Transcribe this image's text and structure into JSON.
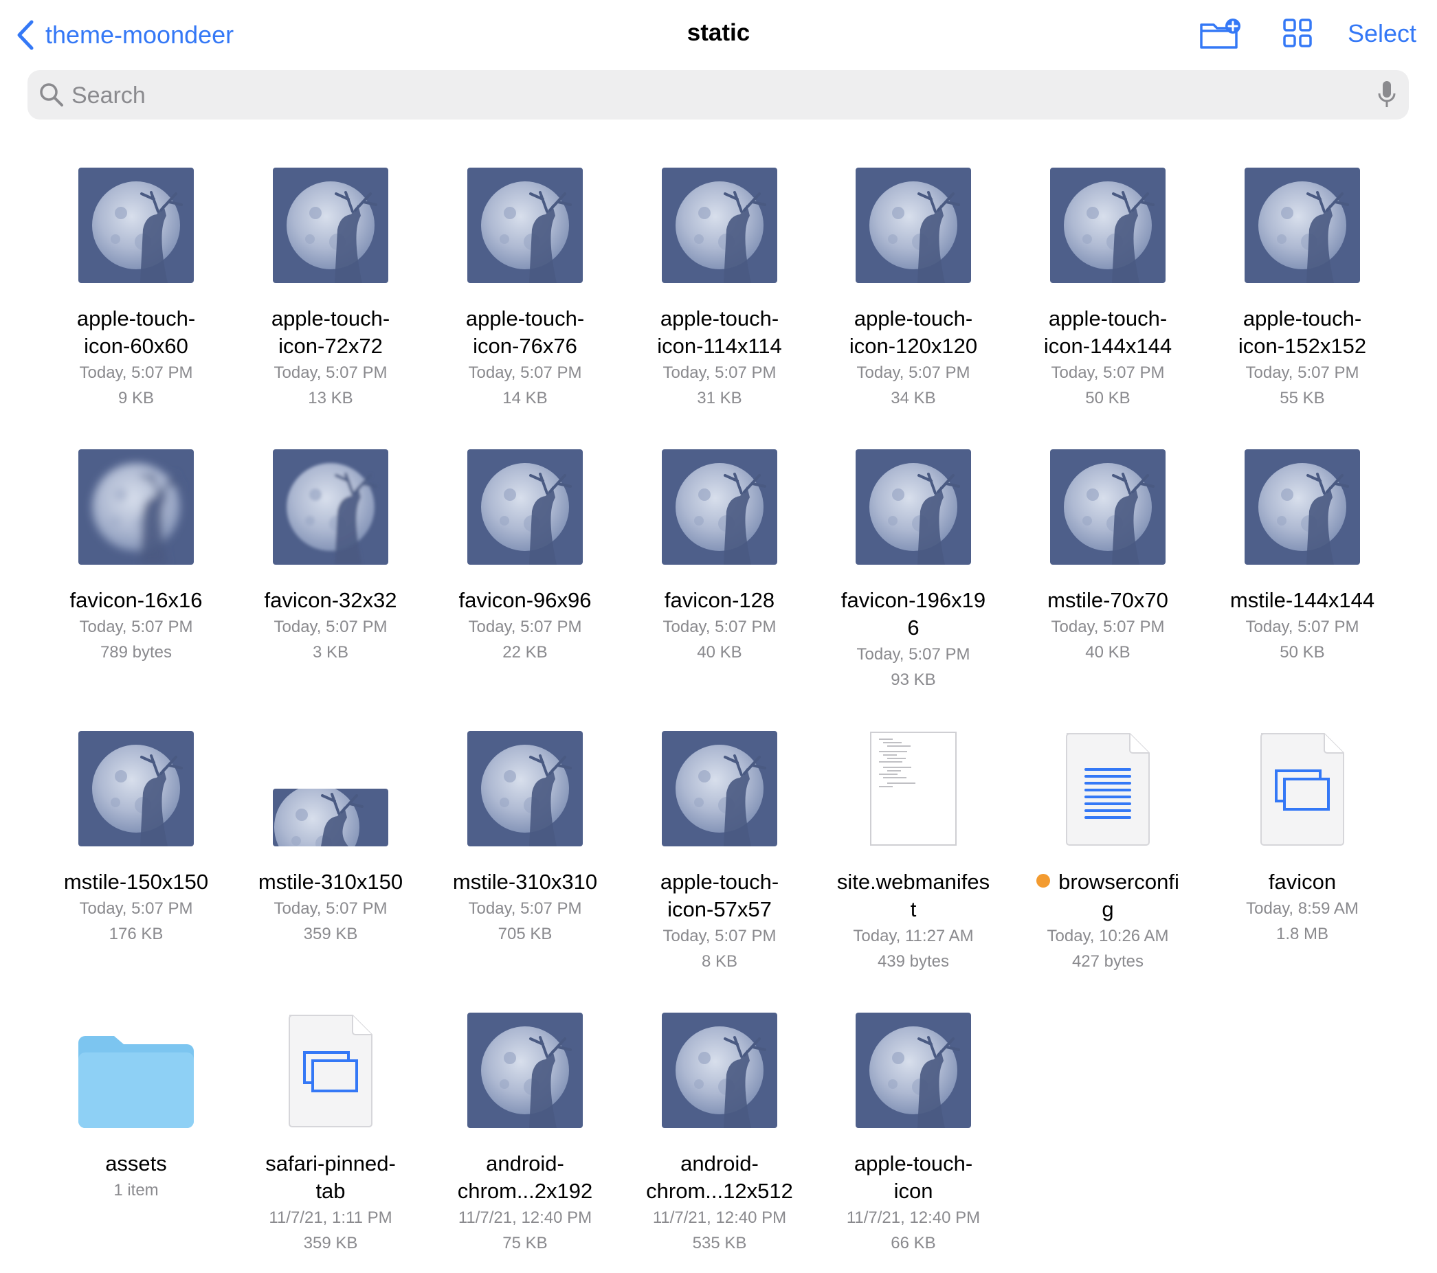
{
  "header": {
    "back_label": "theme-moondeer",
    "title": "static",
    "select_label": "Select"
  },
  "search": {
    "placeholder": "Search"
  },
  "colors": {
    "accent": "#3478f6",
    "thumb_bg": "#4e5f8a",
    "tag_orange": "#f39b30",
    "folder": "#8ed0f5"
  },
  "files": [
    {
      "name": "apple-touch-icon-60x60",
      "name_lines": [
        "apple-touch-",
        "icon-60x60"
      ],
      "date": "Today, 5:07 PM",
      "size": "9 KB",
      "thumb": "moon"
    },
    {
      "name": "apple-touch-icon-72x72",
      "name_lines": [
        "apple-touch-",
        "icon-72x72"
      ],
      "date": "Today, 5:07 PM",
      "size": "13 KB",
      "thumb": "moon"
    },
    {
      "name": "apple-touch-icon-76x76",
      "name_lines": [
        "apple-touch-",
        "icon-76x76"
      ],
      "date": "Today, 5:07 PM",
      "size": "14 KB",
      "thumb": "moon"
    },
    {
      "name": "apple-touch-icon-114x114",
      "name_lines": [
        "apple-touch-",
        "icon-114x114"
      ],
      "date": "Today, 5:07 PM",
      "size": "31 KB",
      "thumb": "moon"
    },
    {
      "name": "apple-touch-icon-120x120",
      "name_lines": [
        "apple-touch-",
        "icon-120x120"
      ],
      "date": "Today, 5:07 PM",
      "size": "34 KB",
      "thumb": "moon"
    },
    {
      "name": "apple-touch-icon-144x144",
      "name_lines": [
        "apple-touch-",
        "icon-144x144"
      ],
      "date": "Today, 5:07 PM",
      "size": "50 KB",
      "thumb": "moon"
    },
    {
      "name": "apple-touch-icon-152x152",
      "name_lines": [
        "apple-touch-",
        "icon-152x152"
      ],
      "date": "Today, 5:07 PM",
      "size": "55 KB",
      "thumb": "moon"
    },
    {
      "name": "favicon-16x16",
      "name_lines": [
        "favicon-16x16"
      ],
      "date": "Today, 5:07 PM",
      "size": "789 bytes",
      "thumb": "moon-blurry"
    },
    {
      "name": "favicon-32x32",
      "name_lines": [
        "favicon-32x32"
      ],
      "date": "Today, 5:07 PM",
      "size": "3 KB",
      "thumb": "moon-pixel"
    },
    {
      "name": "favicon-96x96",
      "name_lines": [
        "favicon-96x96"
      ],
      "date": "Today, 5:07 PM",
      "size": "22 KB",
      "thumb": "moon"
    },
    {
      "name": "favicon-128",
      "name_lines": [
        "favicon-128"
      ],
      "date": "Today, 5:07 PM",
      "size": "40 KB",
      "thumb": "moon"
    },
    {
      "name": "favicon-196x196",
      "name_lines": [
        "favicon-196x19",
        "6"
      ],
      "date": "Today, 5:07 PM",
      "size": "93 KB",
      "thumb": "moon"
    },
    {
      "name": "mstile-70x70",
      "name_lines": [
        "mstile-70x70"
      ],
      "date": "Today, 5:07 PM",
      "size": "40 KB",
      "thumb": "moon"
    },
    {
      "name": "mstile-144x144",
      "name_lines": [
        "mstile-144x144"
      ],
      "date": "Today, 5:07 PM",
      "size": "50 KB",
      "thumb": "moon"
    },
    {
      "name": "mstile-150x150",
      "name_lines": [
        "mstile-150x150"
      ],
      "date": "Today, 5:07 PM",
      "size": "176 KB",
      "thumb": "moon"
    },
    {
      "name": "mstile-310x150",
      "name_lines": [
        "mstile-310x150"
      ],
      "date": "Today, 5:07 PM",
      "size": "359 KB",
      "thumb": "moon-wide"
    },
    {
      "name": "mstile-310x310",
      "name_lines": [
        "mstile-310x310"
      ],
      "date": "Today, 5:07 PM",
      "size": "705 KB",
      "thumb": "moon"
    },
    {
      "name": "apple-touch-icon-57x57",
      "name_lines": [
        "apple-touch-",
        "icon-57x57"
      ],
      "date": "Today, 5:07 PM",
      "size": "8 KB",
      "thumb": "moon"
    },
    {
      "name": "site.webmanifest",
      "name_lines": [
        "site.webmanifes",
        "t"
      ],
      "date": "Today, 11:27 AM",
      "size": "439 bytes",
      "thumb": "text-doc"
    },
    {
      "name": "browserconfig",
      "name_lines": [
        "browserconfi",
        "g"
      ],
      "date": "Today, 10:26 AM",
      "size": "427 bytes",
      "thumb": "lines-doc",
      "tag": "orange"
    },
    {
      "name": "favicon",
      "name_lines": [
        "favicon"
      ],
      "date": "Today, 8:59 AM",
      "size": "1.8 MB",
      "thumb": "windows-doc"
    },
    {
      "name": "assets",
      "name_lines": [
        "assets"
      ],
      "date": "1 item",
      "size": "",
      "thumb": "folder"
    },
    {
      "name": "safari-pinned-tab",
      "name_lines": [
        "safari-pinned-",
        "tab"
      ],
      "date": "11/7/21, 1:11 PM",
      "size": "359 KB",
      "thumb": "windows-doc"
    },
    {
      "name": "android-chrome-192x192",
      "name_lines": [
        "android-",
        "chrom...2x192"
      ],
      "date": "11/7/21, 12:40 PM",
      "size": "75 KB",
      "thumb": "moon"
    },
    {
      "name": "android-chrome-512x512",
      "name_lines": [
        "android-",
        "chrom...12x512"
      ],
      "date": "11/7/21, 12:40 PM",
      "size": "535 KB",
      "thumb": "moon"
    },
    {
      "name": "apple-touch-icon",
      "name_lines": [
        "apple-touch-",
        "icon"
      ],
      "date": "11/7/21, 12:40 PM",
      "size": "66 KB",
      "thumb": "moon"
    }
  ]
}
